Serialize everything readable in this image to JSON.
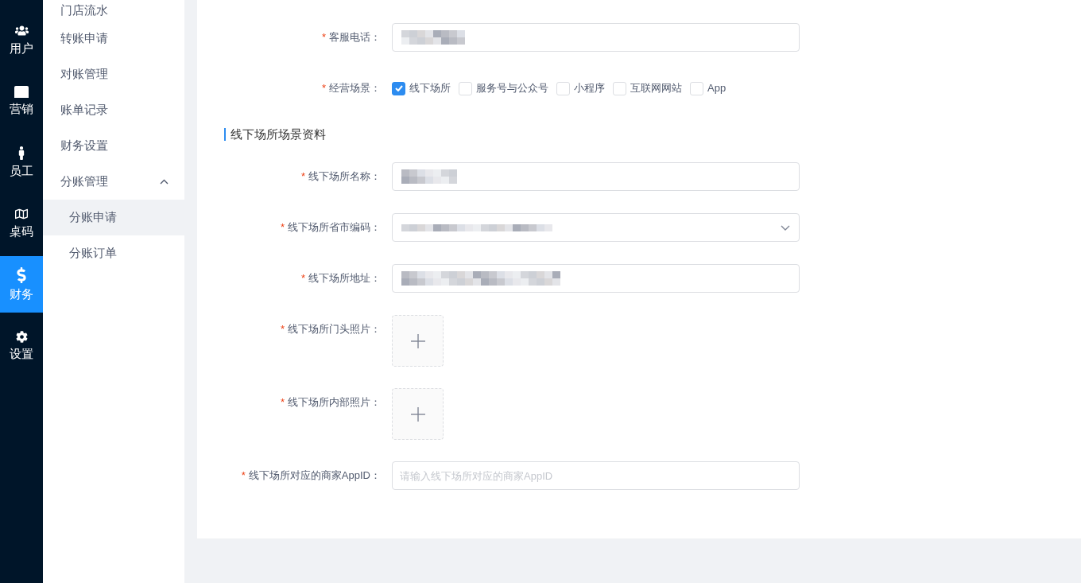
{
  "nav_rail": {
    "items": [
      {
        "label": "用户",
        "selected": false
      },
      {
        "label": "营销",
        "selected": false
      },
      {
        "label": "员工",
        "selected": false
      },
      {
        "label": "桌码",
        "selected": false
      },
      {
        "label": "财务",
        "selected": true
      },
      {
        "label": "设置",
        "selected": false
      }
    ]
  },
  "sidebar": {
    "items": [
      {
        "kind": "link",
        "label": "门店流水",
        "selected": false
      },
      {
        "kind": "link",
        "label": "转账申请",
        "selected": false
      },
      {
        "kind": "link",
        "label": "对账管理",
        "selected": false
      },
      {
        "kind": "link",
        "label": "账单记录",
        "selected": false
      },
      {
        "kind": "link",
        "label": "财务设置",
        "selected": false
      },
      {
        "kind": "group",
        "label": "分账管理",
        "selected": false,
        "expanded": true,
        "children": [
          {
            "label": "分账申请",
            "selected": true
          },
          {
            "label": "分账订单",
            "selected": false
          }
        ]
      }
    ]
  },
  "form": {
    "fields": [
      {
        "kind": "text",
        "required_mark": "*",
        "label": "客服电话：",
        "redacted": true
      },
      {
        "kind": "checkboxes",
        "required_mark": "*",
        "label": "经营场景：",
        "options": [
          {
            "label": "线下场所",
            "checked": true
          },
          {
            "label": "服务号与公众号",
            "checked": false
          },
          {
            "label": "小程序",
            "checked": false
          },
          {
            "label": "互联网网站",
            "checked": false
          },
          {
            "label": "App",
            "checked": false
          }
        ]
      },
      {
        "kind": "section",
        "title": "线下场所场景资料"
      },
      {
        "kind": "text",
        "required_mark": "*",
        "label": "线下场所名称：",
        "redacted": true
      },
      {
        "kind": "select",
        "required_mark": "*",
        "label": "线下场所省市编码：",
        "redacted": true
      },
      {
        "kind": "text",
        "required_mark": "*",
        "label": "线下场所地址：",
        "redacted": true
      },
      {
        "kind": "upload",
        "required_mark": "*",
        "label": "线下场所门头照片："
      },
      {
        "kind": "upload",
        "required_mark": "*",
        "label": "线下场所内部照片："
      },
      {
        "kind": "text",
        "required_mark": "*",
        "label": "线下场所对应的商家AppID：",
        "redacted": false,
        "placeholder": "请输入线下场所对应的商家AppID"
      }
    ]
  }
}
